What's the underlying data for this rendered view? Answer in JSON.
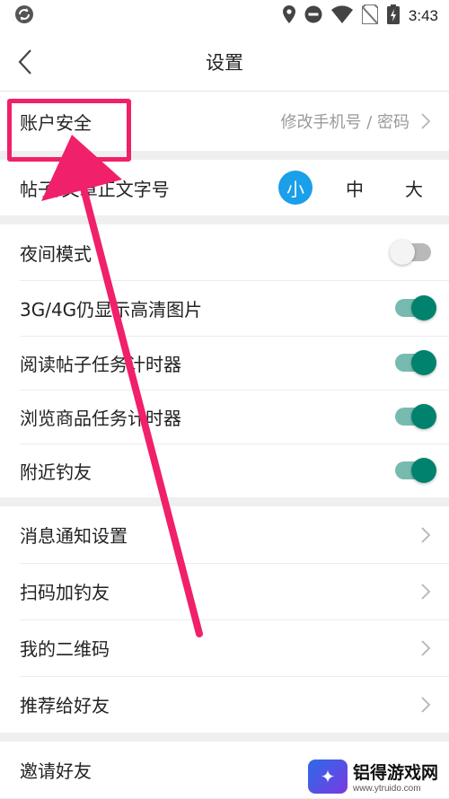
{
  "status_bar": {
    "time": "3:43"
  },
  "header": {
    "title": "设置"
  },
  "account": {
    "label": "账户安全",
    "hint": "修改手机号 / 密码"
  },
  "font_size": {
    "label": "帖子/文章正文字号",
    "options": [
      "小",
      "中",
      "大"
    ],
    "selected": "小"
  },
  "toggles": [
    {
      "label": "夜间模式",
      "on": false
    },
    {
      "label": "3G/4G仍显示高清图片",
      "on": true
    },
    {
      "label": "阅读帖子任务计时器",
      "on": true
    },
    {
      "label": "浏览商品任务计时器",
      "on": true
    },
    {
      "label": "附近钓友",
      "on": true
    }
  ],
  "links": [
    {
      "label": "消息通知设置"
    },
    {
      "label": "扫码加钓友"
    },
    {
      "label": "我的二维码"
    },
    {
      "label": "推荐给好友"
    }
  ],
  "invite": {
    "label": "邀请好友"
  },
  "watermark": {
    "name": "铝得游戏网",
    "url": "www.ytruido.com"
  },
  "colors": {
    "accent": "#1a9fe8",
    "toggle_on": "#00826f",
    "annotation": "#f0206a"
  }
}
